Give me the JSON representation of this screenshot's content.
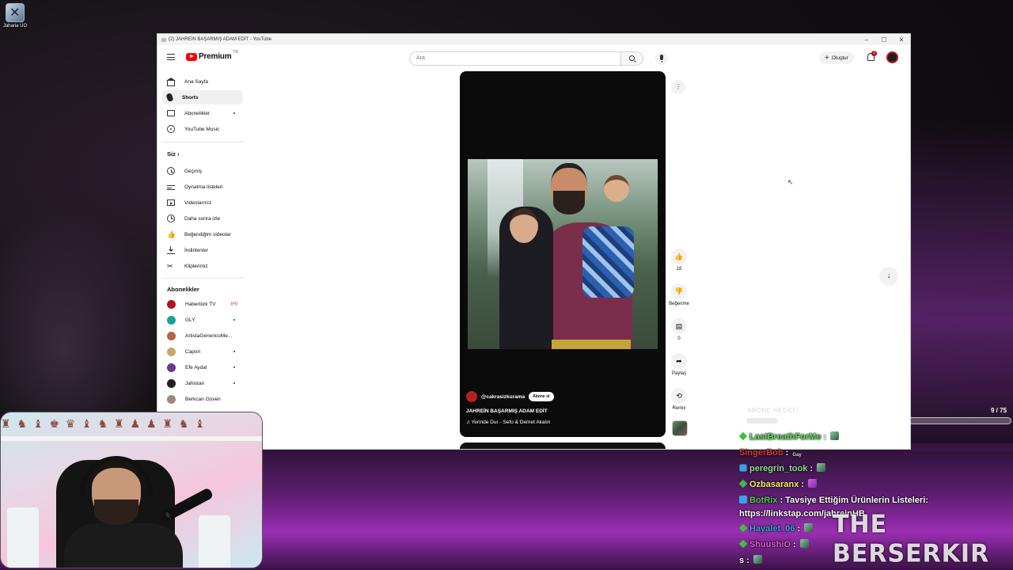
{
  "desktop": {
    "icon_label": "Jaharia UO"
  },
  "window": {
    "title": "(2) JAHREİN BAŞARMIŞ ADAM EDİT - YouTube",
    "controls": {
      "minimize": "–",
      "maximize": "☐",
      "close": "✕"
    }
  },
  "youtube": {
    "logo": "Premium",
    "logo_region": "TR",
    "search_placeholder": "Ara",
    "create_label": "Oluştur",
    "notification_count": "2"
  },
  "sidebar": {
    "main": [
      {
        "label": "Ana Sayfa",
        "icon": "home-icon"
      },
      {
        "label": "Shorts",
        "icon": "shorts-icon",
        "active": true
      },
      {
        "label": "Abonelikler",
        "icon": "subscriptions-icon"
      },
      {
        "label": "YouTube Music",
        "icon": "music-icon"
      }
    ],
    "you_header": "Siz",
    "you": [
      {
        "label": "Geçmiş",
        "icon": "history-icon"
      },
      {
        "label": "Oynatma listeleri",
        "icon": "playlist-icon"
      },
      {
        "label": "Videolarınız",
        "icon": "video-icon"
      },
      {
        "label": "Daha sonra izle",
        "icon": "clock-icon"
      },
      {
        "label": "Beğendiğim videolar",
        "icon": "like-icon"
      },
      {
        "label": "İndirilenler",
        "icon": "download-icon"
      },
      {
        "label": "Kliplerimiz",
        "icon": "clip-icon"
      }
    ],
    "subs_header": "Abonelikler",
    "subscriptions": [
      {
        "label": "Habertürk TV",
        "color": "#b3121f",
        "indicator": "live"
      },
      {
        "label": "GLY",
        "color": "#1aa39a",
        "indicator": "dot"
      },
      {
        "label": "ArtistaGenericoMe...",
        "color": "#b5653f",
        "indicator": ""
      },
      {
        "label": "Capori",
        "color": "#c9a46b",
        "indicator": "dot"
      },
      {
        "label": "Efe Aydal",
        "color": "#6a3a8a",
        "indicator": "dot"
      },
      {
        "label": "Jahistan",
        "color": "#222222",
        "indicator": "dot"
      },
      {
        "label": "Berkcan Güven",
        "color": "#9a8a7a",
        "indicator": ""
      }
    ]
  },
  "short": {
    "channel": "@cakrasizkurama",
    "subscribe_label": "Abone ol",
    "title": "JAHREİN BAŞARMIŞ ADAM EDİT",
    "music": "♫ Yerinde Dur - Sefo & Demet Akalın",
    "actions": {
      "like_count": "18",
      "dislike_label": "Beğenme",
      "comment_count": "0",
      "share_label": "Paylaş",
      "remix_label": "Remix"
    }
  },
  "stream": {
    "sub_goal_label": "ABONE HEDEFİ",
    "sub_goal_count": "9 / 75",
    "sub_goal_progress": 0.12,
    "watermark": "THE BERSERKIR",
    "chat": [
      {
        "user": "LastBreathForMe",
        "color": "#5ee05e",
        "badge": "diamond",
        "text": "",
        "emote": "emote"
      },
      {
        "user": "SingerBob",
        "color": "#d23b3b",
        "badge": "",
        "text": "",
        "emote": "gay"
      },
      {
        "user": "peregrin_took",
        "color": "#8fe08f",
        "badge": "gem",
        "text": "",
        "emote": "emote"
      },
      {
        "user": "Ozbasaranx",
        "color": "#f2f25a",
        "badge": "diamond",
        "text": "",
        "emote": "feather"
      },
      {
        "user": "BotRix",
        "color": "#55c855",
        "badge": "mod",
        "text": "Tavsiye Ettiğim Ürünlerin Listeleri:",
        "emote": ""
      },
      {
        "user": "",
        "color": "#ffffff",
        "badge": "",
        "text": "https://linkstap.com/jahreinHB",
        "emote": ""
      },
      {
        "user": "Hayalet_06",
        "color": "#3fa0e0",
        "badge": "diamond",
        "text": "",
        "emote": "emote"
      },
      {
        "user": "ShuushiO",
        "color": "#e05bd9",
        "badge": "diamond",
        "text": "",
        "emote": "emote"
      },
      {
        "user": "s",
        "color": "#ffffff",
        "badge": "",
        "text": "",
        "emote": "emote"
      }
    ]
  }
}
